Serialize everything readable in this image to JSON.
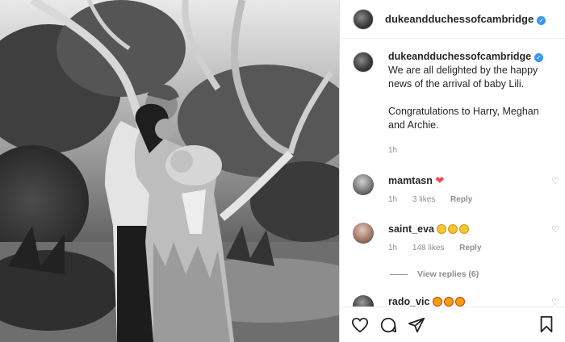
{
  "post": {
    "handle": "dukeandduchessofcambridge",
    "verified": true
  },
  "caption": {
    "handle": "dukeandduchessofcambridge",
    "text": "We are all delighted by the happy news of the arrival of baby Lili.",
    "text2": "Congratulations to Harry, Meghan and Archie.",
    "time": "1h"
  },
  "comments": [
    {
      "handle": "mamtasn",
      "emoji": "heart",
      "time": "1h",
      "likes": "3 likes",
      "reply": "Reply"
    },
    {
      "handle": "saint_eva",
      "emoji": "faces",
      "time": "1h",
      "likes": "148 likes",
      "reply": "Reply"
    },
    {
      "handle": "rado_vic",
      "emoji": "stars"
    }
  ],
  "view_replies": "View replies (6)",
  "icons": {
    "like": "heart-icon",
    "comment": "comment-icon",
    "share": "paper-plane-icon",
    "save": "bookmark-icon"
  },
  "colors": {
    "verified": "#3897f0",
    "heart": "#ed4956",
    "muted": "#8e8e8e"
  }
}
